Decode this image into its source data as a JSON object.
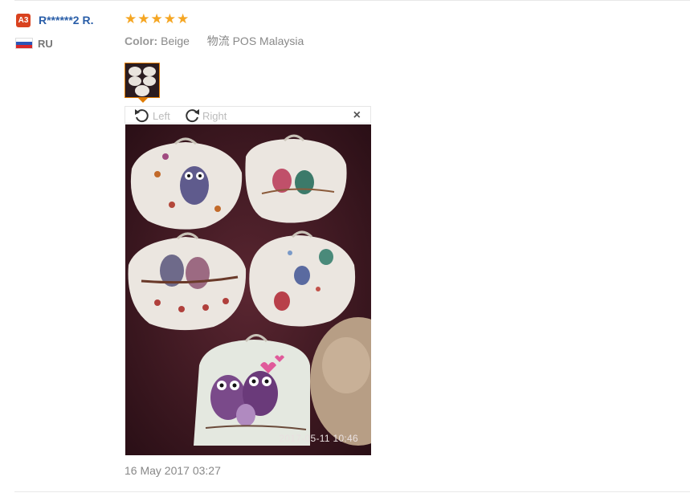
{
  "reviewer": {
    "level_badge": "A3",
    "name": "R******2 R.",
    "country": "RU"
  },
  "review": {
    "rating": 5,
    "color_label": "Color:",
    "color_value": "Beige",
    "shipping_label": "物流",
    "shipping_value": "POS Malaysia",
    "date": "16 May 2017 03:27"
  },
  "viewer": {
    "rotate_left_label": "Left",
    "rotate_right_label": "Right",
    "close_glyph": "×",
    "photo_timestamp": "2017-05-11 10:46"
  },
  "colors": {
    "link": "#2a5ea8",
    "star": "#f5a623",
    "badge": "#d9421f",
    "thumb_border": "#e07b00"
  }
}
